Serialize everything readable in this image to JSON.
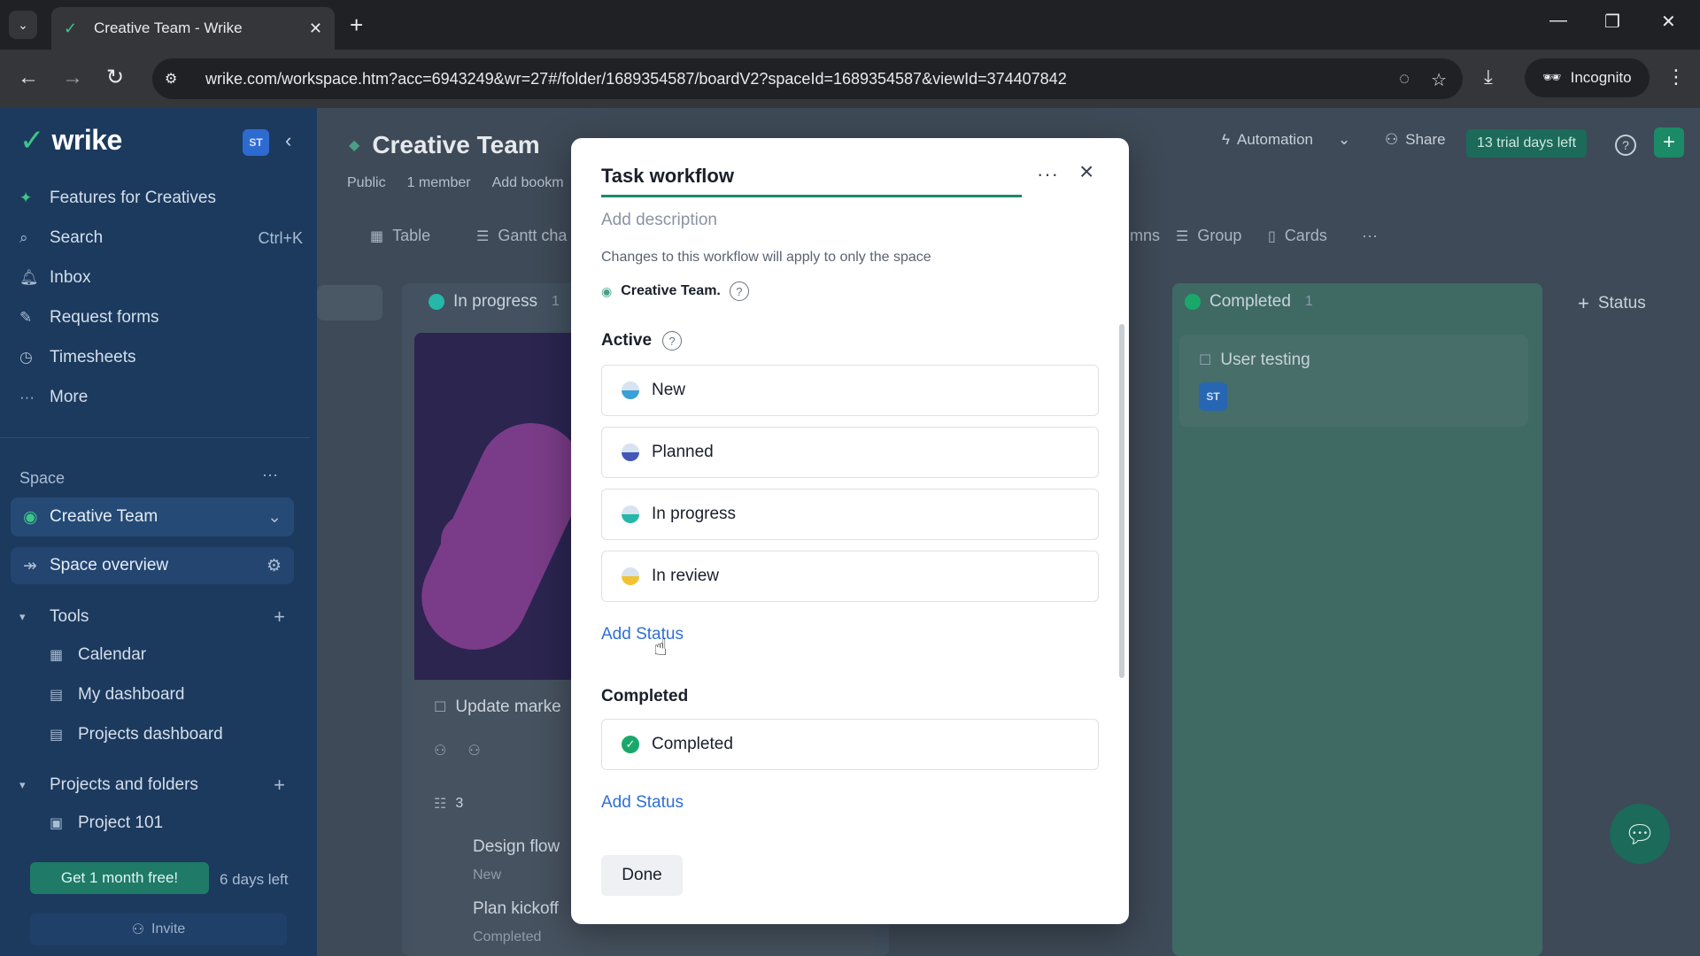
{
  "browser": {
    "tab_title": "Creative Team - Wrike",
    "url": "wrike.com/workspace.htm?acc=6943249&wr=27#/folder/1689354587/boardV2?spaceId=1689354587&viewId=374407842",
    "incognito_label": "Incognito"
  },
  "sidebar": {
    "brand": "wrike",
    "avatar": "ST",
    "nav": [
      {
        "label": "Features for Creatives",
        "icon": "sparkle-icon"
      },
      {
        "label": "Search",
        "hint": "Ctrl+K",
        "icon": "search-icon"
      },
      {
        "label": "Inbox",
        "icon": "bell-icon"
      },
      {
        "label": "Request forms",
        "icon": "form-icon"
      },
      {
        "label": "Timesheets",
        "icon": "clock-icon"
      },
      {
        "label": "More",
        "icon": "more-icon"
      }
    ],
    "space_label": "Space",
    "space_name": "Creative Team",
    "space_overview": "Space overview",
    "tools_label": "Tools",
    "tools": [
      "Calendar",
      "My dashboard",
      "Projects dashboard"
    ],
    "projects_label": "Projects and folders",
    "projects": [
      "Project 101"
    ],
    "promo": "Get 1 month free!",
    "days_left": "6 days left",
    "invite": "Invite"
  },
  "main": {
    "title": "Creative Team",
    "meta": [
      "Public",
      "1 member",
      "Add bookm"
    ],
    "automation": "Automation",
    "share": "Share",
    "trial": "13 trial days left",
    "tabs": [
      "Table",
      "Gantt cha"
    ],
    "right_tools": [
      "mns",
      "Group",
      "Cards"
    ],
    "col_in_progress": "In progress",
    "col_in_progress_count": "1",
    "col_completed": "Completed",
    "col_completed_count": "1",
    "add_status_col": "Status",
    "card_update": "Update marke",
    "subtask_count": "3",
    "subtasks": [
      {
        "title": "Design flow",
        "status": "New"
      },
      {
        "title": "Plan kickoff",
        "status": "Completed"
      }
    ],
    "completed_card": "User testing",
    "completed_card_avatar": "ST"
  },
  "modal": {
    "title": "Task workflow",
    "add_description": "Add description",
    "note": "Changes to this workflow will apply to only the space",
    "space_ref": "Creative Team.",
    "active_label": "Active",
    "active_statuses": [
      {
        "label": "New",
        "color": "#3aa0d8"
      },
      {
        "label": "Planned",
        "color": "#4257b8"
      },
      {
        "label": "In progress",
        "color": "#25b7a7"
      },
      {
        "label": "In review",
        "color": "#f2c233"
      }
    ],
    "add_status": "Add Status",
    "completed_label": "Completed",
    "completed_statuses": [
      {
        "label": "Completed",
        "color": "#1aa86a"
      }
    ],
    "add_status_2": "Add Status",
    "done": "Done"
  }
}
